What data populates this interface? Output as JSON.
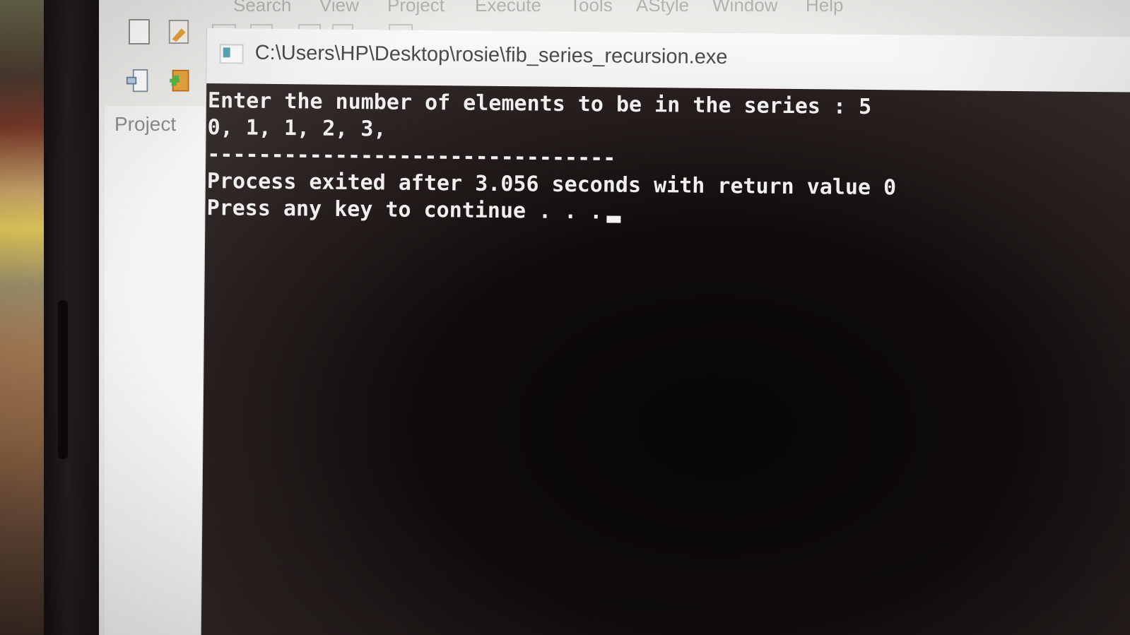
{
  "menu": {
    "items": [
      "Search",
      "View",
      "Project",
      "Execute",
      "Tools",
      "AStyle",
      "Window",
      "Help"
    ]
  },
  "toolbar": {
    "icons": [
      "new-file-icon",
      "open-file-icon",
      "insert-icon",
      "add-icon"
    ]
  },
  "project_panel": {
    "tab_label": "Project"
  },
  "console": {
    "title": "C:\\Users\\HP\\Desktop\\rosie\\fib_series_recursion.exe",
    "lines": [
      "Enter the number of elements to be in the series : 5",
      "0, 1, 1, 2, 3,",
      "--------------------------------",
      "Process exited after 3.056 seconds with return value 0",
      "Press any key to continue . . ."
    ]
  },
  "colors": {
    "console_text": "#efefef",
    "console_background": "#0c0909",
    "ide_background": "#ecebe8"
  }
}
